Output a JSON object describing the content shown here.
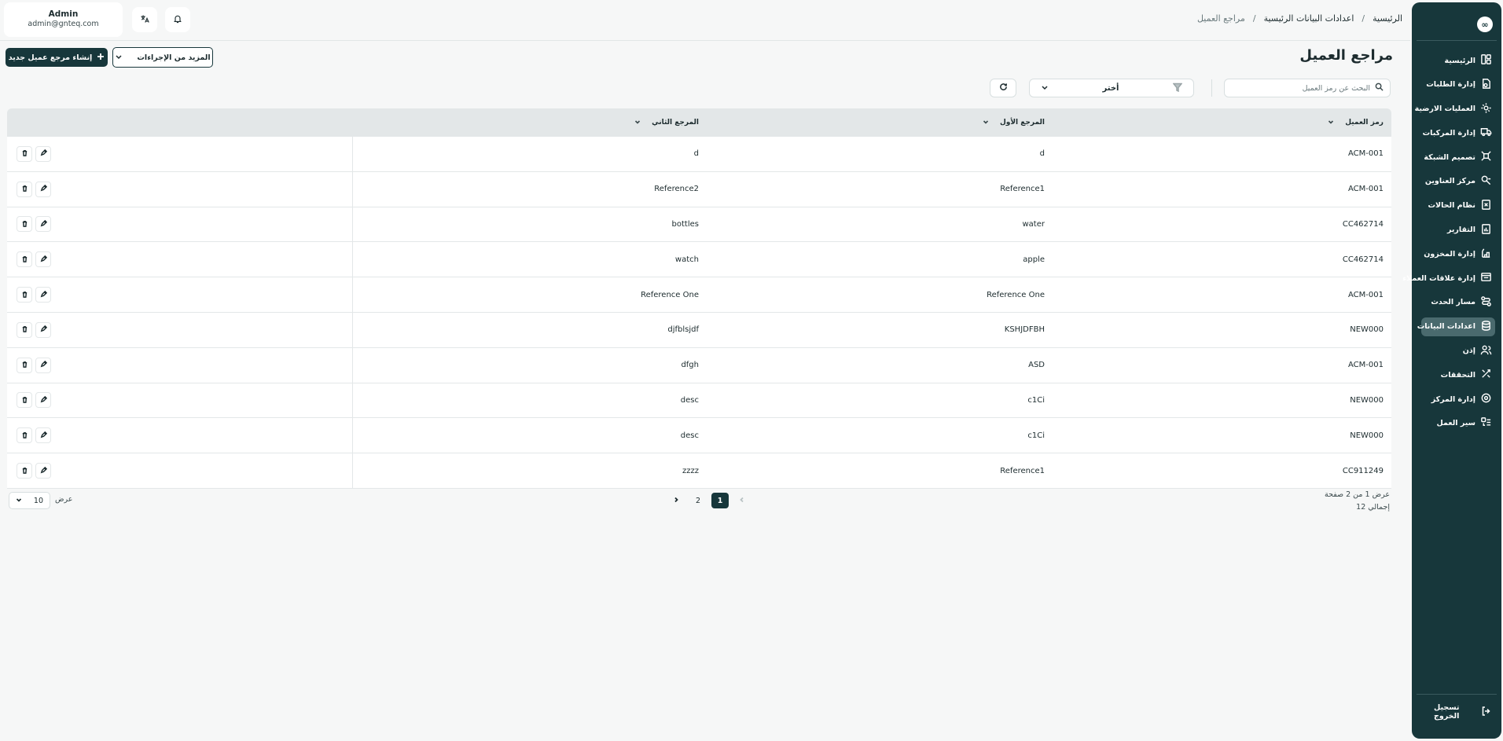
{
  "user": {
    "name": "Admin",
    "email": "admin@gnteq.com"
  },
  "breadcrumb": {
    "home": "الرئيسية",
    "section": "اعدادات البيانات الرئيسية",
    "current": "مراجع العميل",
    "separator": "/"
  },
  "page": {
    "title": "مراجع العميل",
    "create_label": "إنشاء مرجع عميل جديد",
    "more_actions_label": "المزيد من الإجراءات"
  },
  "search": {
    "placeholder": "البحث عن رمز العميل",
    "value": ""
  },
  "filter": {
    "selected": "أختر"
  },
  "sidebar": {
    "logo": "∞",
    "items": [
      {
        "label": "الرئيسية",
        "icon": "dashboard-icon",
        "active": false
      },
      {
        "label": "إدارة الطلبات",
        "icon": "orders-icon",
        "active": false
      },
      {
        "label": "العمليات الارضية",
        "icon": "ground-ops-icon",
        "active": false
      },
      {
        "label": "إدارة المركبات",
        "icon": "truck-icon",
        "active": false
      },
      {
        "label": "تصميم الشبكة",
        "icon": "network-icon",
        "active": false
      },
      {
        "label": "مركز العناوين",
        "icon": "address-icon",
        "active": false
      },
      {
        "label": "نظام الحالات",
        "icon": "status-icon",
        "active": false
      },
      {
        "label": "التقارير",
        "icon": "reports-icon",
        "active": false
      },
      {
        "label": "إدارة المخزون",
        "icon": "inventory-icon",
        "active": false
      },
      {
        "label": "إدارة علاقات العملاء",
        "icon": "crm-icon",
        "active": false
      },
      {
        "label": "مسار الحدث",
        "icon": "route-icon",
        "active": false
      },
      {
        "label": "اعدادات البيانات",
        "icon": "database-icon",
        "active": true
      },
      {
        "label": "إذن",
        "icon": "users-icon",
        "active": false
      },
      {
        "label": "التحققات",
        "icon": "tools-icon",
        "active": false
      },
      {
        "label": "إدارة المركز",
        "icon": "hub-icon",
        "active": false
      },
      {
        "label": "سير العمل",
        "icon": "workflow-icon",
        "active": false
      }
    ],
    "logout_label": "تسجيل الخروج"
  },
  "table": {
    "columns": [
      {
        "label": "رمز العميل"
      },
      {
        "label": "المرجع الأول"
      },
      {
        "label": "المرجع الثاني"
      }
    ],
    "rows": [
      {
        "code": "ACM-001",
        "ref1": "d",
        "ref2": "d"
      },
      {
        "code": "ACM-001",
        "ref1": "Reference1",
        "ref2": "Reference2"
      },
      {
        "code": "CC462714",
        "ref1": "water",
        "ref2": "bottles"
      },
      {
        "code": "CC462714",
        "ref1": "apple",
        "ref2": "watch"
      },
      {
        "code": "ACM-001",
        "ref1": "Reference One",
        "ref2": "Reference One"
      },
      {
        "code": "NEW000",
        "ref1": "KSHJDFBH",
        "ref2": "djfblsjdf"
      },
      {
        "code": "ACM-001",
        "ref1": "ASD",
        "ref2": "dfgh"
      },
      {
        "code": "NEW000",
        "ref1": "c1Ci",
        "ref2": "desc"
      },
      {
        "code": "NEW000",
        "ref1": "c1Ci",
        "ref2": "desc"
      },
      {
        "code": "CC911249",
        "ref1": "Reference1",
        "ref2": "zzzz"
      }
    ]
  },
  "pagination": {
    "info_line1": "عرض 1 من 2 صفحة",
    "info_line2": "إجمالي 12",
    "pages": [
      "1",
      "2"
    ],
    "current_page": "1",
    "page_size": "10",
    "page_size_label": "عرض"
  },
  "colors": {
    "primary": "#17373b",
    "header_bg": "#e3e7e8",
    "page_bg": "#f6f7f7"
  }
}
